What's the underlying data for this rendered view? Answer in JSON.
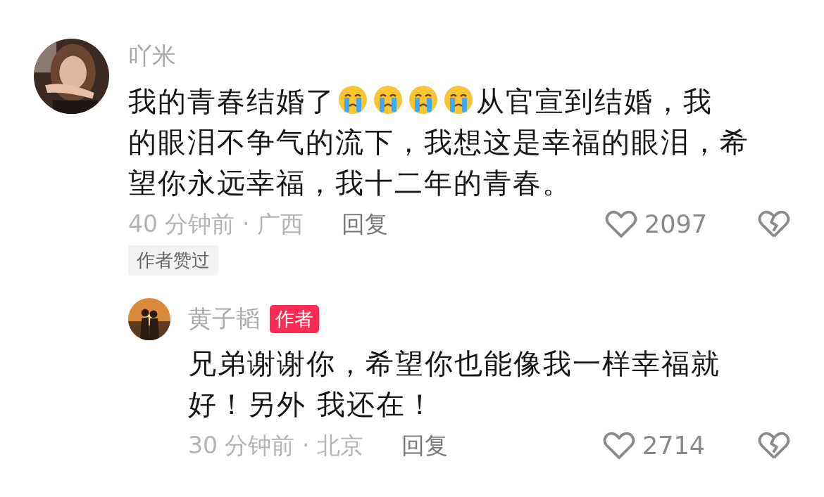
{
  "comments": [
    {
      "user": "吖米",
      "avatar": {
        "kind": "picture"
      },
      "lines": [
        [
          {
            "kind": "text",
            "text": "我的青春结婚了"
          },
          {
            "kind": "emoji"
          },
          {
            "kind": "emoji"
          },
          {
            "kind": "emoji"
          },
          {
            "kind": "emoji"
          },
          {
            "kind": "text",
            "text": "从官宣到结婚，我"
          }
        ],
        [
          {
            "kind": "text",
            "text": "的眼泪不争气的流下，我想这是幸福的眼泪，希"
          }
        ],
        [
          {
            "kind": "text",
            "text": "望你永远幸福，我十二年的青春。"
          }
        ]
      ],
      "time": "40 分钟前 · 广西",
      "reply": "回复",
      "likes": "2097",
      "tag": "作者赞过",
      "replies": [
        {
          "user": "黄子韬",
          "badge": "作者",
          "avatar": {
            "kind": "picture"
          },
          "lines": [
            [
              {
                "kind": "text",
                "text": "兄弟谢谢你，希望你也能像我一样幸福就"
              }
            ],
            [
              {
                "kind": "text",
                "text": "好！另外 我还在！"
              }
            ]
          ],
          "time": "30 分钟前 · 北京",
          "reply": "回复",
          "likes": "2714"
        }
      ]
    }
  ]
}
